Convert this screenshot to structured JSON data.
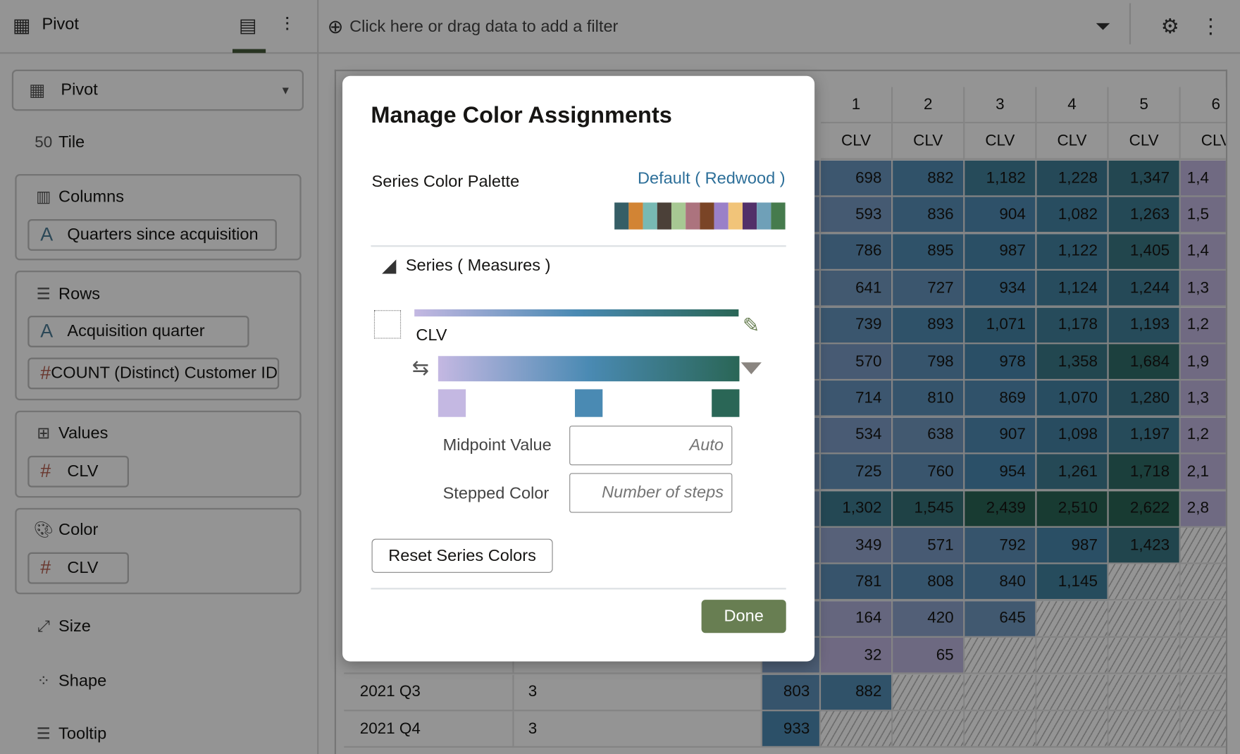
{
  "header": {
    "title": "Pivot",
    "filter_placeholder": "Click here or drag data to add a filter"
  },
  "left_panel": {
    "viz_type": "Pivot",
    "tile": "Tile",
    "columns": {
      "label": "Columns",
      "items": [
        "Quarters since acquisition"
      ]
    },
    "rows": {
      "label": "Rows",
      "items": [
        "Acquisition quarter",
        "COUNT (Distinct) Customer ID"
      ]
    },
    "values": {
      "label": "Values",
      "items": [
        "CLV"
      ]
    },
    "color": {
      "label": "Color",
      "items": [
        "CLV"
      ]
    },
    "size": "Size",
    "shape": "Shape",
    "tooltip": "Tooltip"
  },
  "table": {
    "col_headers": [
      "1",
      "2",
      "3",
      "4",
      "5",
      "6"
    ],
    "measure": "CLV",
    "rows": [
      {
        "label": "",
        "count": "",
        "c0": "",
        "cells": [
          "698",
          "882",
          "1,182",
          "1,228",
          "1,347",
          "1,4"
        ]
      },
      {
        "label": "",
        "count": "",
        "c0": "",
        "cells": [
          "593",
          "836",
          "904",
          "1,082",
          "1,263",
          "1,5"
        ]
      },
      {
        "label": "",
        "count": "",
        "c0": "",
        "cells": [
          "786",
          "895",
          "987",
          "1,122",
          "1,405",
          "1,4"
        ]
      },
      {
        "label": "",
        "count": "",
        "c0": "",
        "cells": [
          "641",
          "727",
          "934",
          "1,124",
          "1,244",
          "1,3"
        ]
      },
      {
        "label": "",
        "count": "",
        "c0": "",
        "cells": [
          "739",
          "893",
          "1,071",
          "1,178",
          "1,193",
          "1,2"
        ]
      },
      {
        "label": "",
        "count": "",
        "c0": "",
        "cells": [
          "570",
          "798",
          "978",
          "1,358",
          "1,684",
          "1,9"
        ]
      },
      {
        "label": "",
        "count": "",
        "c0": "",
        "cells": [
          "714",
          "810",
          "869",
          "1,070",
          "1,280",
          "1,3"
        ]
      },
      {
        "label": "",
        "count": "",
        "c0": "",
        "cells": [
          "534",
          "638",
          "907",
          "1,098",
          "1,197",
          "1,2"
        ]
      },
      {
        "label": "",
        "count": "",
        "c0": "",
        "cells": [
          "725",
          "760",
          "954",
          "1,261",
          "1,718",
          "2,1"
        ]
      },
      {
        "label": "",
        "count": "",
        "c0": "",
        "cells": [
          "1,302",
          "1,545",
          "2,439",
          "2,510",
          "2,622",
          "2,8"
        ]
      },
      {
        "label": "",
        "count": "",
        "c0": "",
        "cells": [
          "349",
          "571",
          "792",
          "987",
          "1,423",
          null
        ]
      },
      {
        "label": "",
        "count": "",
        "c0": "",
        "cells": [
          "781",
          "808",
          "840",
          "1,145",
          null,
          null
        ]
      },
      {
        "label": "",
        "count": "",
        "c0": "",
        "cells": [
          "164",
          "420",
          "645",
          null,
          null,
          null
        ]
      },
      {
        "label": "",
        "count": "",
        "c0": "",
        "cells": [
          "32",
          "65",
          null,
          null,
          null,
          null
        ]
      },
      {
        "label": "2021 Q3",
        "count": "3",
        "c0": "803",
        "cells": [
          "882",
          null,
          null,
          null,
          null,
          null
        ]
      },
      {
        "label": "2021 Q4",
        "count": "3",
        "c0": "933",
        "cells": [
          null,
          null,
          null,
          null,
          null,
          null
        ]
      }
    ]
  },
  "dialog": {
    "title": "Manage Color Assignments",
    "palette_label": "Series Color Palette",
    "palette_name": "Default ( Redwood )",
    "palette_colors": [
      "#355e66",
      "#d28434",
      "#78b9b3",
      "#4b4038",
      "#a7c893",
      "#ac737e",
      "#7a4426",
      "#9a80c8",
      "#f1c479",
      "#523069",
      "#6fa0b8",
      "#467b4d"
    ],
    "section": "Series ( Measures )",
    "series_name": "CLV",
    "gradient_stops": [
      "#c4b8e2",
      "#4a8ab3",
      "#2a6656"
    ],
    "midpoint_label": "Midpoint Value",
    "midpoint_placeholder": "Auto",
    "stepped_label": "Stepped Color",
    "stepped_placeholder": "Number of steps",
    "reset_label": "Reset Series Colors",
    "done_label": "Done",
    "link_color": "#2d6f99",
    "done_color": "#687e52"
  }
}
